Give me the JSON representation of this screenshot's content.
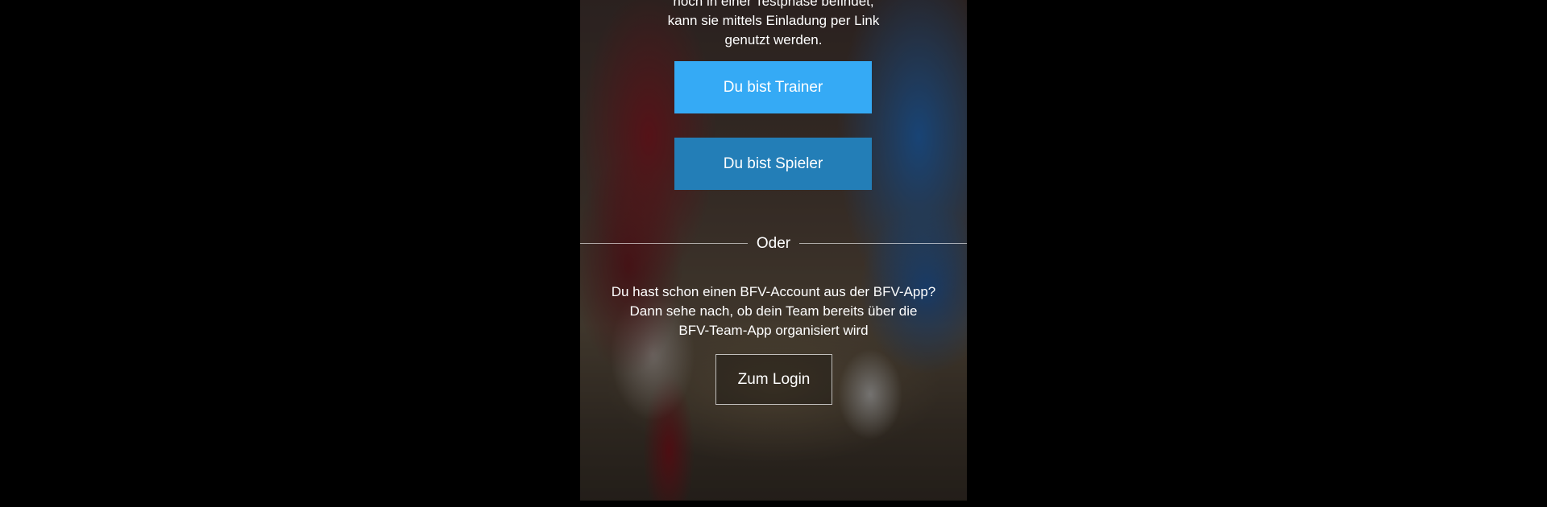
{
  "intro": {
    "line1": "noch in einer Testphase befindet,",
    "line2": "kann sie mittels Einladung per Link",
    "line3": "genutzt werden."
  },
  "buttons": {
    "trainer_label": "Du bist Trainer",
    "spieler_label": "Du bist Spieler",
    "login_label": "Zum Login"
  },
  "divider": {
    "label": "Oder"
  },
  "account": {
    "line1": "Du hast schon einen BFV-Account aus der BFV-App?",
    "line2": "Dann sehe nach, ob dein Team bereits über die",
    "line3": "BFV-Team-App organisiert wird"
  },
  "colors": {
    "trainer_button": "#35aaf5",
    "spieler_button": "#237eb7",
    "outer_background": "#000000"
  }
}
